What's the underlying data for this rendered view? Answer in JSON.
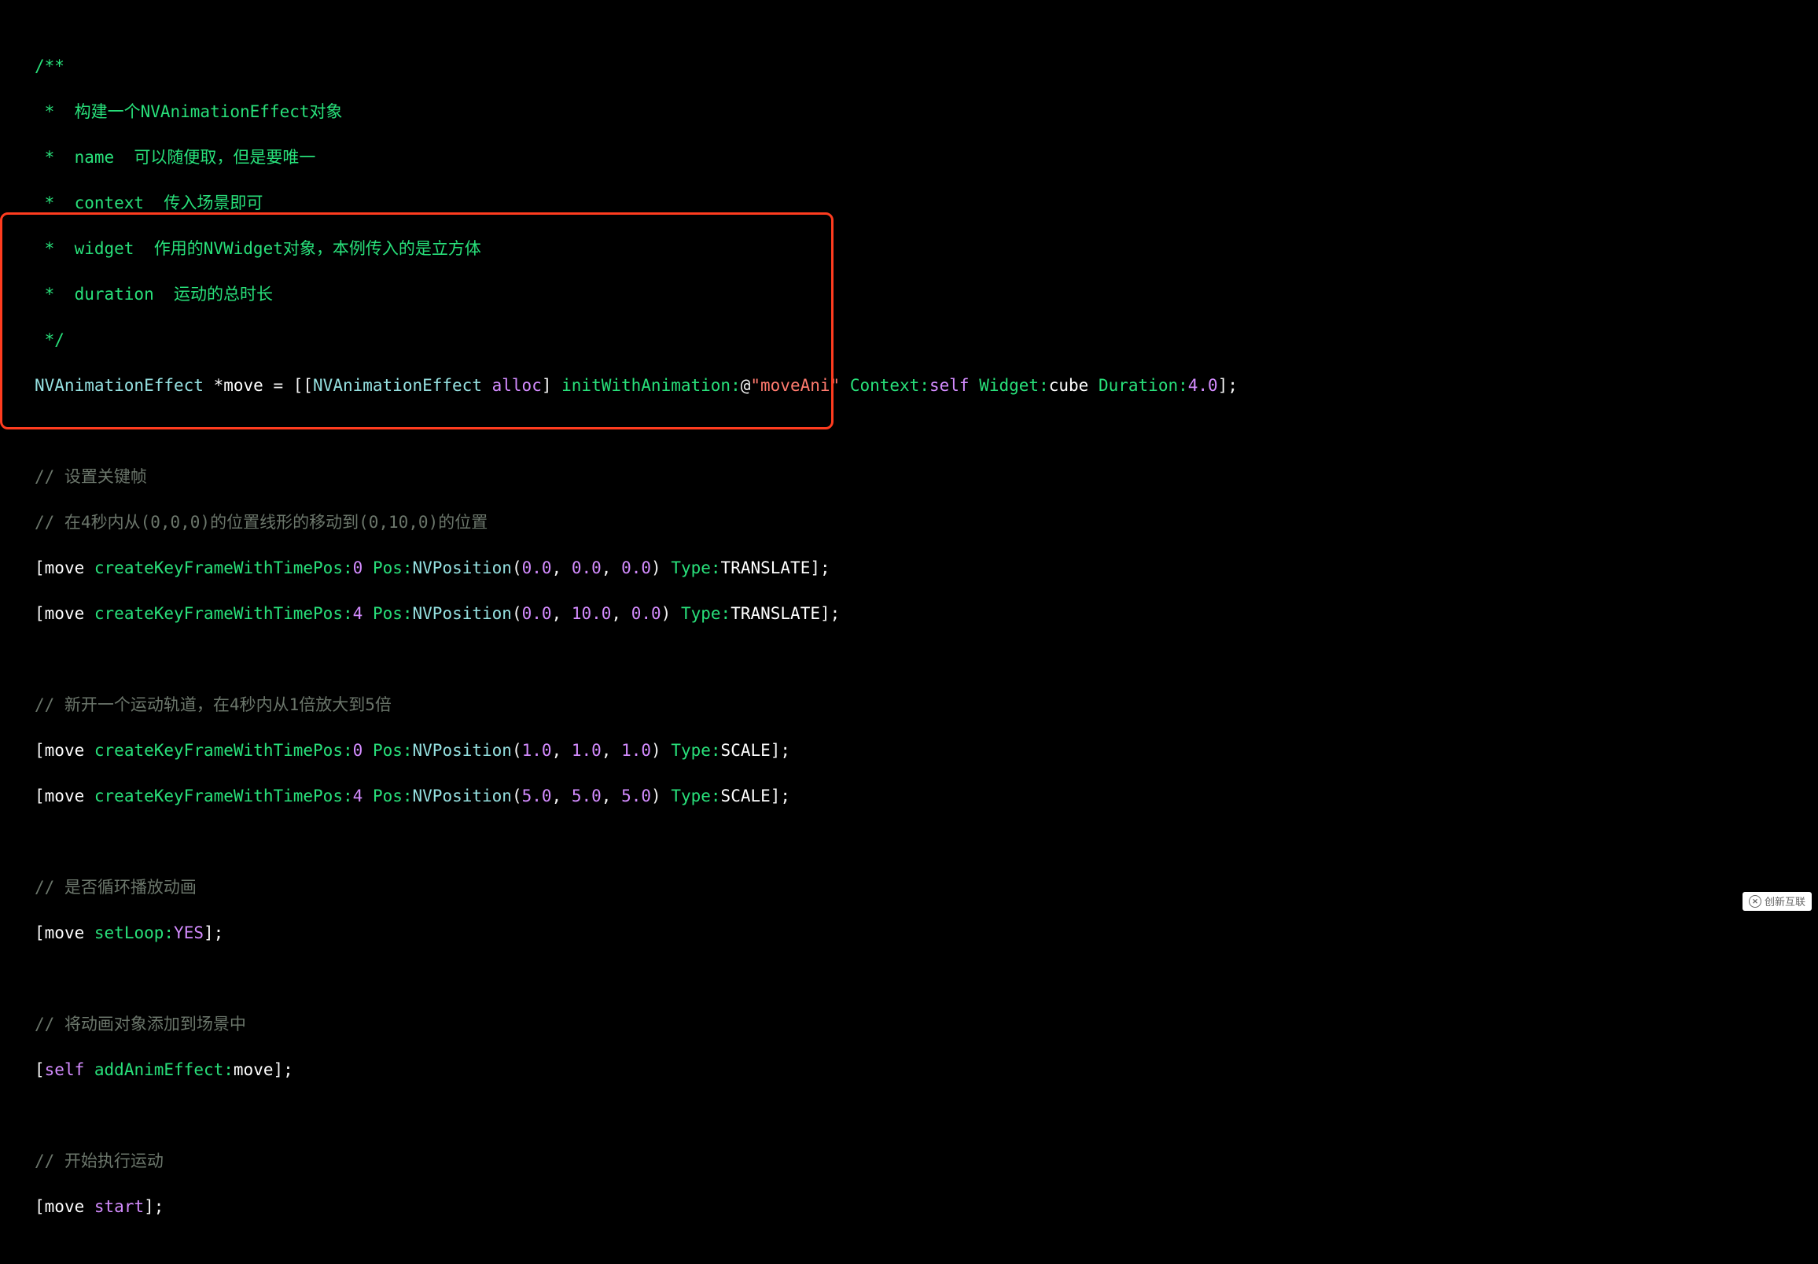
{
  "doc": {
    "l1": "/**",
    "l2": " *  构建一个NVAnimationEffect对象",
    "l3": " *  name  可以随便取，但是要唯一",
    "l4": " *  context  传入场景即可",
    "l5": " *  widget  作用的NVWidget对象，本例传入的是立方体",
    "l6": " *  duration  运动的总时长",
    "l7": " */"
  },
  "init": {
    "cls": "NVAnimationEffect",
    "star": " *",
    "var": "move",
    "eq": " = [[",
    "cls2": "NVAnimationEffect",
    "sp": " ",
    "alloc": "alloc",
    "mid": "] ",
    "sel1": "initWithAnimation:",
    "at": "@",
    "str": "\"moveAni\"",
    "sp2": " ",
    "sel2": "Context:",
    "self": "self",
    "sp3": " ",
    "sel3": "Widget:",
    "cube": "cube",
    "sp4": " ",
    "sel4": "Duration:",
    "dur": "4.0",
    "end": "];"
  },
  "c1": "// 设置关键帧",
  "c2": "// 在4秒内从(0,0,0)的位置线形的移动到(0,10,0)的位置",
  "kf": {
    "open": "[",
    "move": "move",
    "sp": " ",
    "sel_time": "createKeyFrameWithTimePos:",
    "t0": "0",
    "t4": "4",
    "sp2": " ",
    "sel_pos": "Pos:",
    "nvpos": "NVPosition",
    "lp": "(",
    "rp": ")",
    "comma": ", ",
    "n00": "0.0",
    "n10": "10.0",
    "n1": "1.0",
    "n5": "5.0",
    "sp3": " ",
    "sel_type": "Type:",
    "translate": "TRANSLATE",
    "scale": "SCALE",
    "close": "];"
  },
  "c3": "// 新开一个运动轨道，在4秒内从1倍放大到5倍",
  "c4": "// 是否循环播放动画",
  "loop": {
    "open": "[",
    "move": "move",
    "sp": " ",
    "sel": "setLoop:",
    "yes": "YES",
    "close": "];"
  },
  "c5": "// 将动画对象添加到场景中",
  "add": {
    "open": "[",
    "self": "self",
    "sp": " ",
    "sel": "addAnimEffect:",
    "move": "move",
    "close": "];"
  },
  "c6": "// 开始执行运动",
  "start": {
    "open": "[",
    "move": "move",
    "sp": " ",
    "sel": "start",
    "close": "];"
  },
  "watermark_text": "创新互联"
}
